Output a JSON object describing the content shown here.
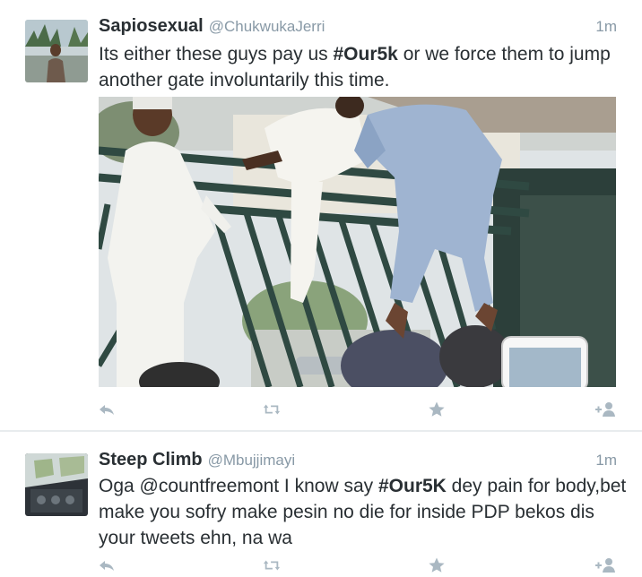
{
  "tweets": [
    {
      "name": "Sapiosexual",
      "handle": "@ChukwukaJerri",
      "time": "1m",
      "text_parts": {
        "p1": "Its either these guys pay us ",
        "tag": "#Our5k",
        "p2": " or we force them to jump another gate involuntarily this time."
      },
      "has_photo": true
    },
    {
      "name": "Steep Climb",
      "handle": "@Mbujjimayi",
      "time": "1m",
      "text_parts": {
        "p1": "Oga ",
        "mention": "@countfreemont",
        "p2": " I know say ",
        "tag": "#Our5K",
        "p3": " dey pain for body,bet make you sofry make pesin no die for inside  PDP bekos dis your tweets ehn, na wa"
      },
      "has_photo": false
    }
  ],
  "icons": {
    "reply": "reply-icon",
    "retweet": "retweet-icon",
    "favorite": "star-icon",
    "follow": "follow-icon"
  },
  "colors": {
    "text": "#292f33",
    "muted": "#8899a6",
    "icon": "#aab8c2"
  }
}
